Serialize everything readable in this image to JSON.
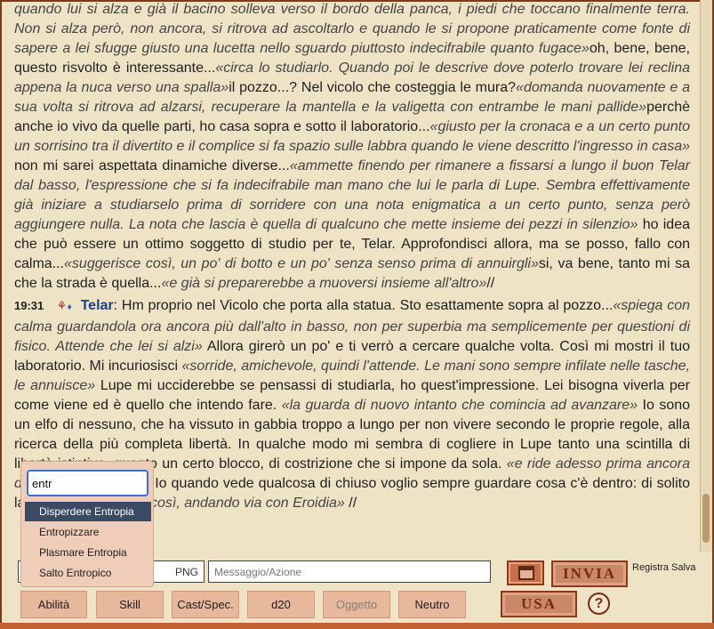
{
  "chat": {
    "paragraph1": {
      "segments": [
        {
          "t": "quando lui si alza e già il bacino solleva verso il bordo della panca, i piedi che toccano finalmente terra. Non si alza però, non ancora, si ritrova ad ascoltarlo e quando le si propone praticamente come fonte di sapere a lei sfugge giusto una lucetta nello sguardo piuttosto indecifrabile quanto fugace»",
          "i": true
        },
        {
          "t": "oh, bene, bene, questo risvolto è interessante...",
          "i": false
        },
        {
          "t": "«circa lo studiarlo. Quando poi le descrive dove poterlo trovare lei reclina appena la nuca verso una spalla»",
          "i": true
        },
        {
          "t": "il pozzo...? Nel vicolo che costeggia le mura?",
          "i": false
        },
        {
          "t": "«domanda nuovamente e a sua volta si ritrova ad alzarsi, recuperare la mantella e la valigetta con entrambe le mani pallide»",
          "i": true
        },
        {
          "t": "perchè anche io vivo da quelle parti, ho casa sopra e sotto il laboratorio...",
          "i": false
        },
        {
          "t": "«giusto per la cronaca e a un certo punto un sorrisino tra il divertito e il complice si fa spazio sulle labbra quando le viene descritto l'ingresso in casa»",
          "i": true
        },
        {
          "t": " non mi sarei aspettata dinamiche diverse...",
          "i": false
        },
        {
          "t": "«ammette finendo per rimanere a fissarsi a lungo il buon Telar dal basso, l'espressione che si fa indecifrabile man mano che lui le parla di Lupe. Sembra effettivamente già iniziare a studiarselo prima di sorridere con una nota enigmatica a un certo punto, senza però aggiungere nulla. La nota che lascia è quella di qualcuno che mette insieme dei pezzi in silenzio»",
          "i": true
        },
        {
          "t": " ho idea che può essere un ottimo soggetto di studio per te, Telar. Approfondisci allora, ma se posso, fallo con calma...",
          "i": false
        },
        {
          "t": "«suggerisce così, un po' di botto e un po' senza senso prima di annuirgli»",
          "i": true
        },
        {
          "t": "si, va bene, tanto mi sa che la strada è quella...",
          "i": false
        },
        {
          "t": "«e già si preparerebbe a muoversi insieme all'altro»",
          "i": true
        },
        {
          "t": "//",
          "i": false
        }
      ]
    },
    "paragraph2": {
      "time": "19:31",
      "symbol": "⚘",
      "gem": "♦",
      "name": "Telar",
      "colon": ":",
      "segments": [
        {
          "t": " Hm proprio nel Vicolo che porta alla statua. Sto esattamente sopra al pozzo...",
          "i": false
        },
        {
          "t": "«spiega con calma guardandola ora ancora più dall'alto in basso, non per superbia ma semplicemente per questioni di fisico. Attende che lei si alzi»",
          "i": true
        },
        {
          "t": " Allora girerò un po' e ti verrò a cercare qualche volta. Così mi mostri il tuo laboratorio. Mi incuriosisci ",
          "i": false
        },
        {
          "t": "«sorride, amichevole, quindi l'attende. Le mani sono sempre infilate nelle tasche, le annuisce»",
          "i": true
        },
        {
          "t": " Lupe mi ucciderebbe se pensassi di studiarla, ho quest'impressione. Lei bisogna viverla per come viene ed è quello che intendo fare. ",
          "i": false
        },
        {
          "t": "«la guarda di nuovo intanto che comincia ad avanzare»",
          "i": true
        },
        {
          "t": " Io sono un elfo di nessuno, che ha vissuto in gabbia troppo a lungo per non vivere secondo le proprie regole, alla ricerca della più completa libertà. In qualche modo mi sembra di cogliere in Lupe tanto una scintilla di libertà istintiva, quanto un certo blocco, di costrizione che si impone da sola. ",
          "i": false
        },
        {
          "t": "«e ride adesso prima ancora della prossima frase»",
          "i": true
        },
        {
          "t": " Io quando vede qualcosa di chiuso voglio sempre guardare cosa c'è dentro: di solito la apro...",
          "i": false
        },
        {
          "t": "«e conclude così, andando via con Eroidia»",
          "i": true
        },
        {
          "t": " //",
          "i": false
        }
      ]
    }
  },
  "form": {
    "png_value": "PNG",
    "message_placeholder": "Messaggio/Azione",
    "send_label": "INVIA",
    "use_label": "USA",
    "save_label": "Registra Salva",
    "help_label": "?"
  },
  "actions": [
    {
      "label": "Abilità",
      "enabled": true
    },
    {
      "label": "Skill",
      "enabled": true
    },
    {
      "label": "Cast/Spec.",
      "enabled": true
    },
    {
      "label": "d20",
      "enabled": true
    },
    {
      "label": "Oggetto",
      "enabled": false
    },
    {
      "label": "Neutro",
      "enabled": true
    }
  ],
  "autocomplete": {
    "query": "entr",
    "options": [
      "Disperdere Entropia",
      "Entropizzare",
      "Plasmare Entropia",
      "Salto Entropico"
    ],
    "selected_index": 0
  },
  "colors": {
    "background": "#efe3c6",
    "accent": "#7a3b1c",
    "name": "#1c3f8c",
    "button": "#e7b89c"
  }
}
